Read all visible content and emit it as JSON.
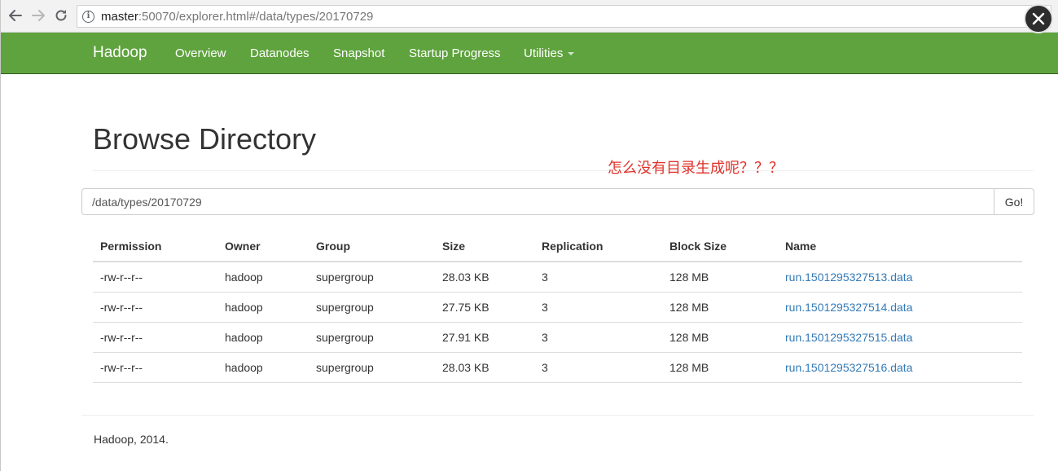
{
  "browser": {
    "url_host": "master",
    "url_rest": ":50070/explorer.html#/data/types/20170729",
    "back_icon": "arrow-left-icon",
    "forward_icon": "arrow-right-icon",
    "reload_icon": "reload-icon",
    "info_icon": "info-icon",
    "info_glyph": "i",
    "close_icon": "close-icon"
  },
  "navbar": {
    "brand": "Hadoop",
    "color": "#5fa33e",
    "items": [
      "Overview",
      "Datanodes",
      "Snapshot",
      "Startup Progress",
      "Utilities"
    ]
  },
  "page": {
    "title": "Browse Directory",
    "annotation": "怎么没有目录生成呢？？？",
    "annotation_color": "#e0322b",
    "path_value": "/data/types/20170729",
    "go_label": "Go!"
  },
  "table": {
    "headers": [
      "Permission",
      "Owner",
      "Group",
      "Size",
      "Replication",
      "Block Size",
      "Name"
    ],
    "rows": [
      [
        "-rw-r--r--",
        "hadoop",
        "supergroup",
        "28.03 KB",
        "3",
        "128 MB",
        "run.1501295327513.data"
      ],
      [
        "-rw-r--r--",
        "hadoop",
        "supergroup",
        "27.75 KB",
        "3",
        "128 MB",
        "run.1501295327514.data"
      ],
      [
        "-rw-r--r--",
        "hadoop",
        "supergroup",
        "27.91 KB",
        "3",
        "128 MB",
        "run.1501295327515.data"
      ],
      [
        "-rw-r--r--",
        "hadoop",
        "supergroup",
        "28.03 KB",
        "3",
        "128 MB",
        "run.1501295327516.data"
      ]
    ],
    "link_color": "#337ab7"
  },
  "footer": {
    "text": "Hadoop, 2014."
  }
}
